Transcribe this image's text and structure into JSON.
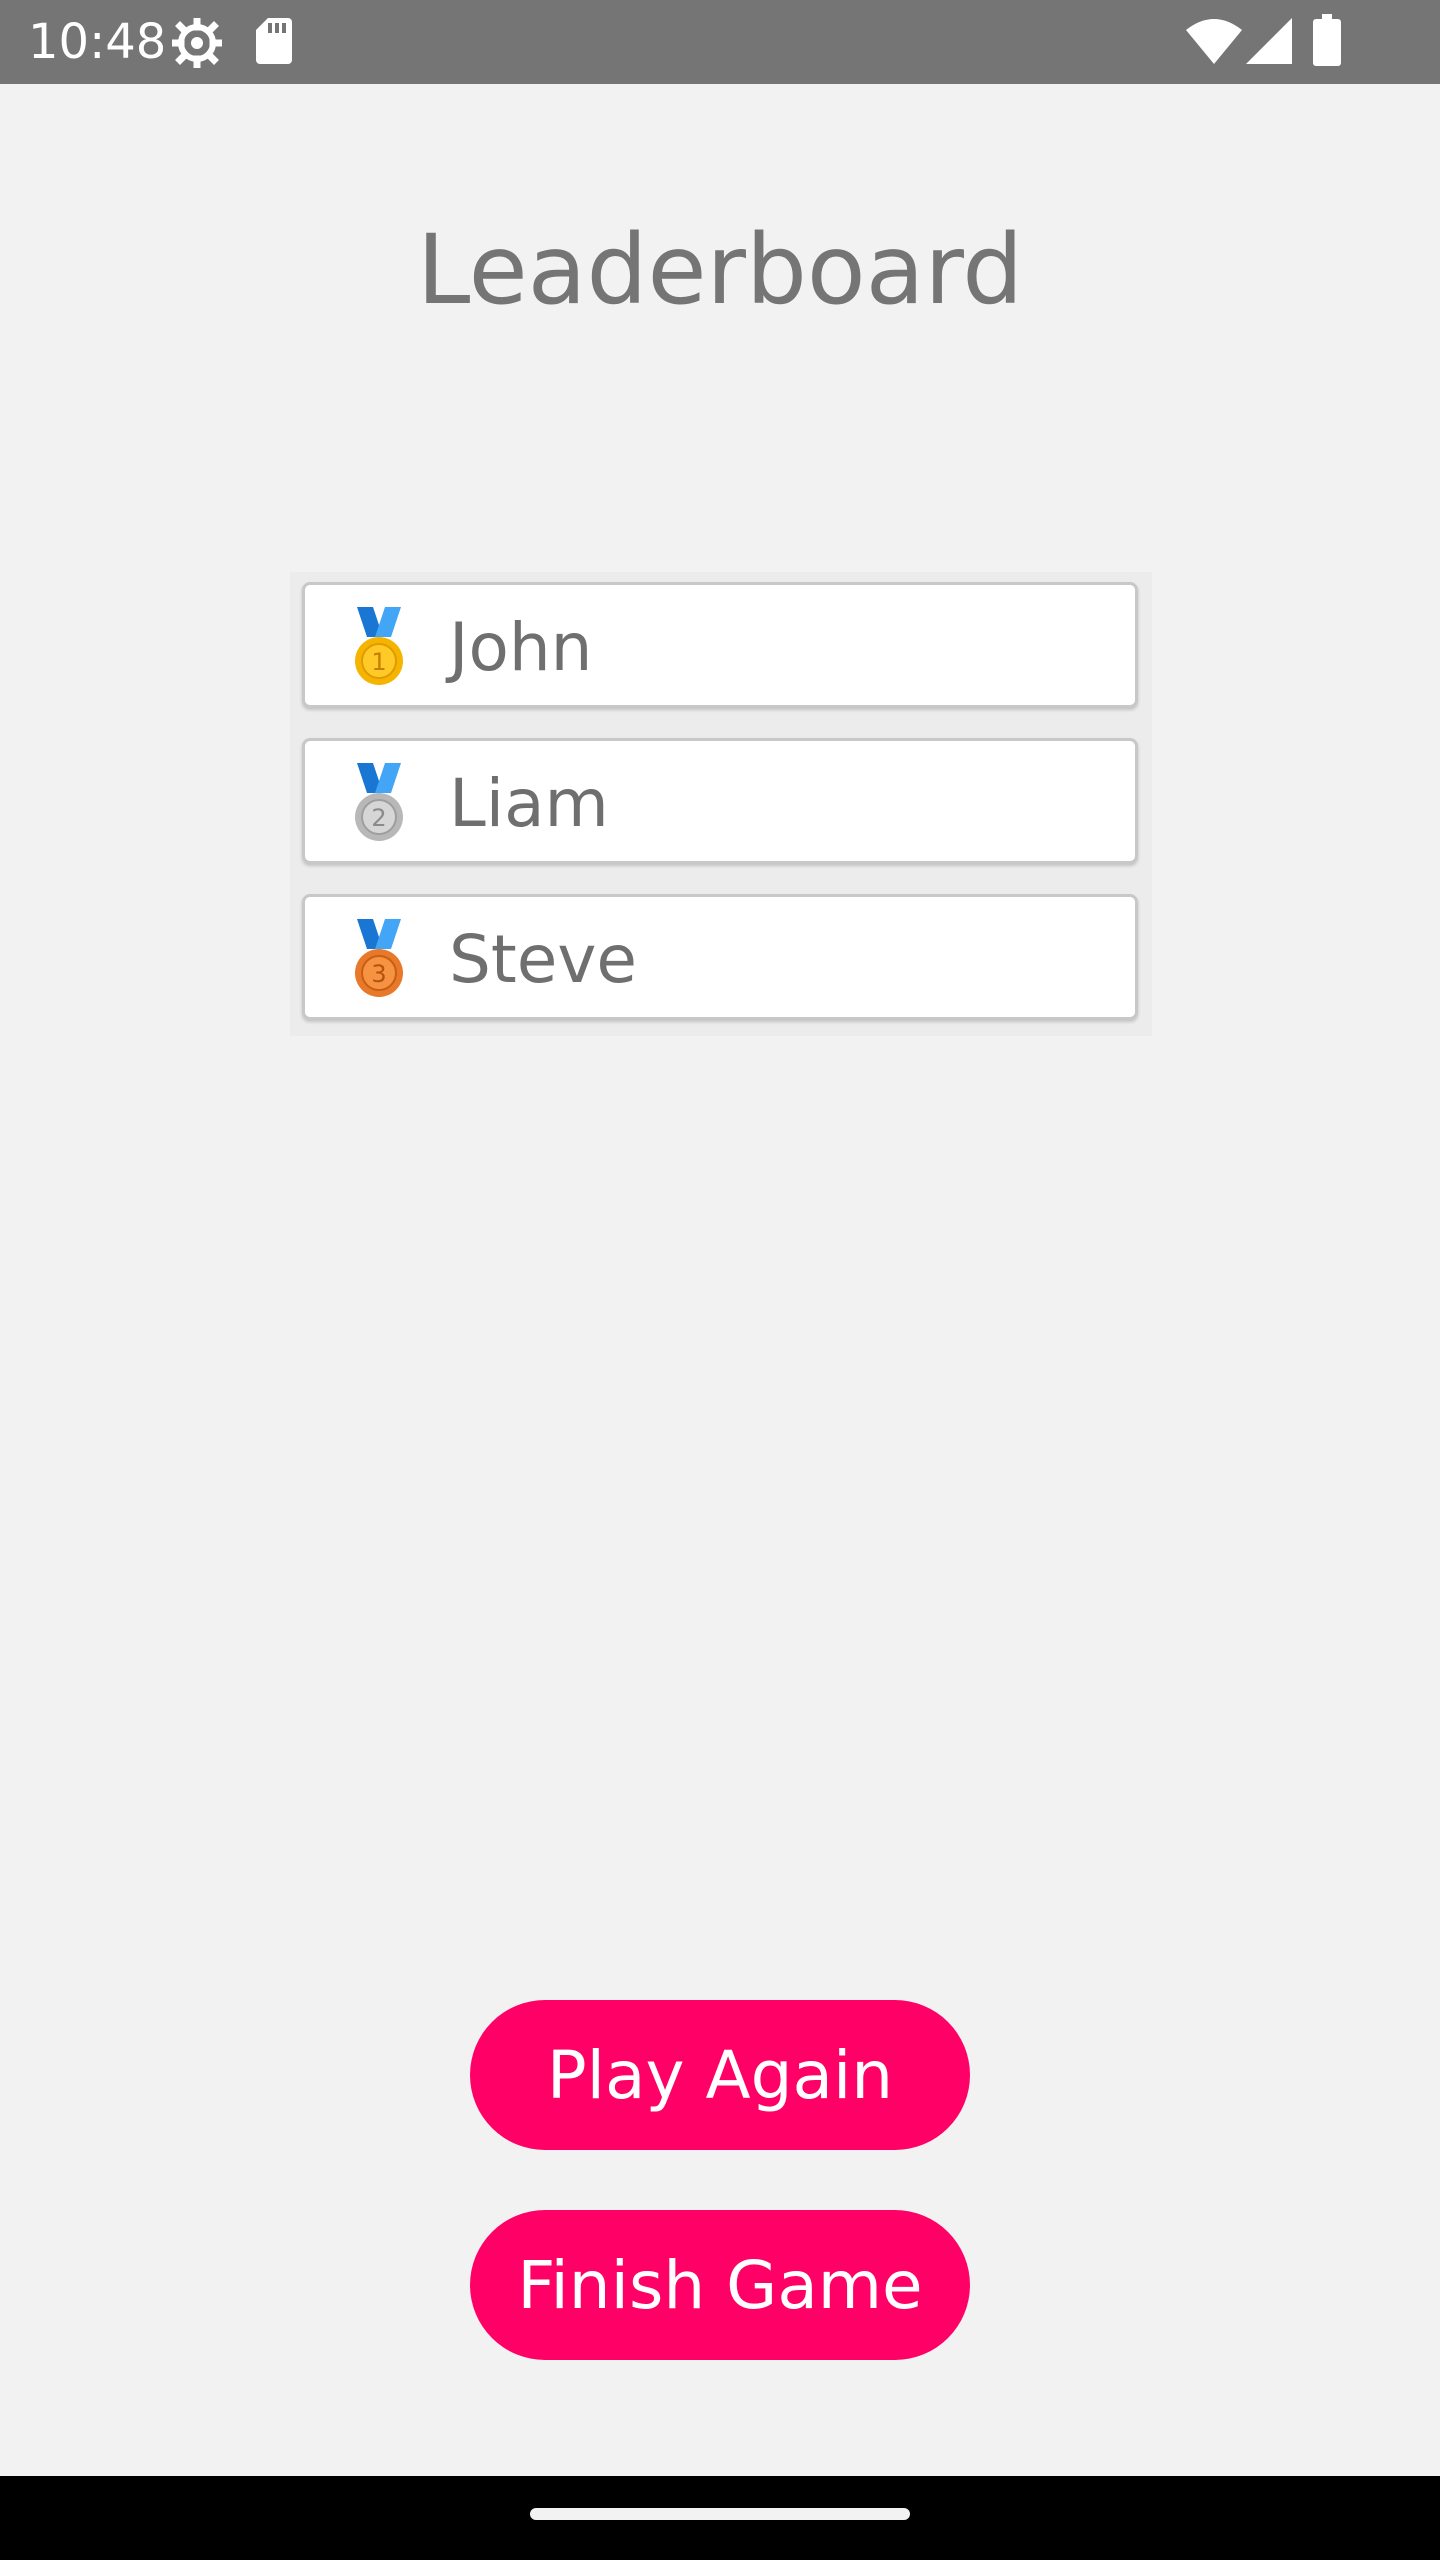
{
  "status_bar": {
    "time": "10:48",
    "icons": [
      "settings-gear-icon",
      "sd-card-icon",
      "wifi-icon",
      "cell-signal-icon",
      "battery-icon"
    ]
  },
  "screen": {
    "title": "Leaderboard"
  },
  "leaderboard": {
    "entries": [
      {
        "rank": 1,
        "name": "John",
        "medal": "gold-medal-icon"
      },
      {
        "rank": 2,
        "name": "Liam",
        "medal": "silver-medal-icon"
      },
      {
        "rank": 3,
        "name": "Steve",
        "medal": "bronze-medal-icon"
      }
    ]
  },
  "actions": {
    "play_again": "Play Again",
    "finish_game": "Finish Game"
  },
  "colors": {
    "accent": "#ff0066",
    "background": "#f2f2f2",
    "status_bar": "#757575",
    "title_text": "#757575",
    "medal_gold": "#f5b400",
    "medal_silver": "#b8b8b8",
    "medal_bronze": "#e8782a",
    "medal_ribbon": "#1976d2"
  }
}
